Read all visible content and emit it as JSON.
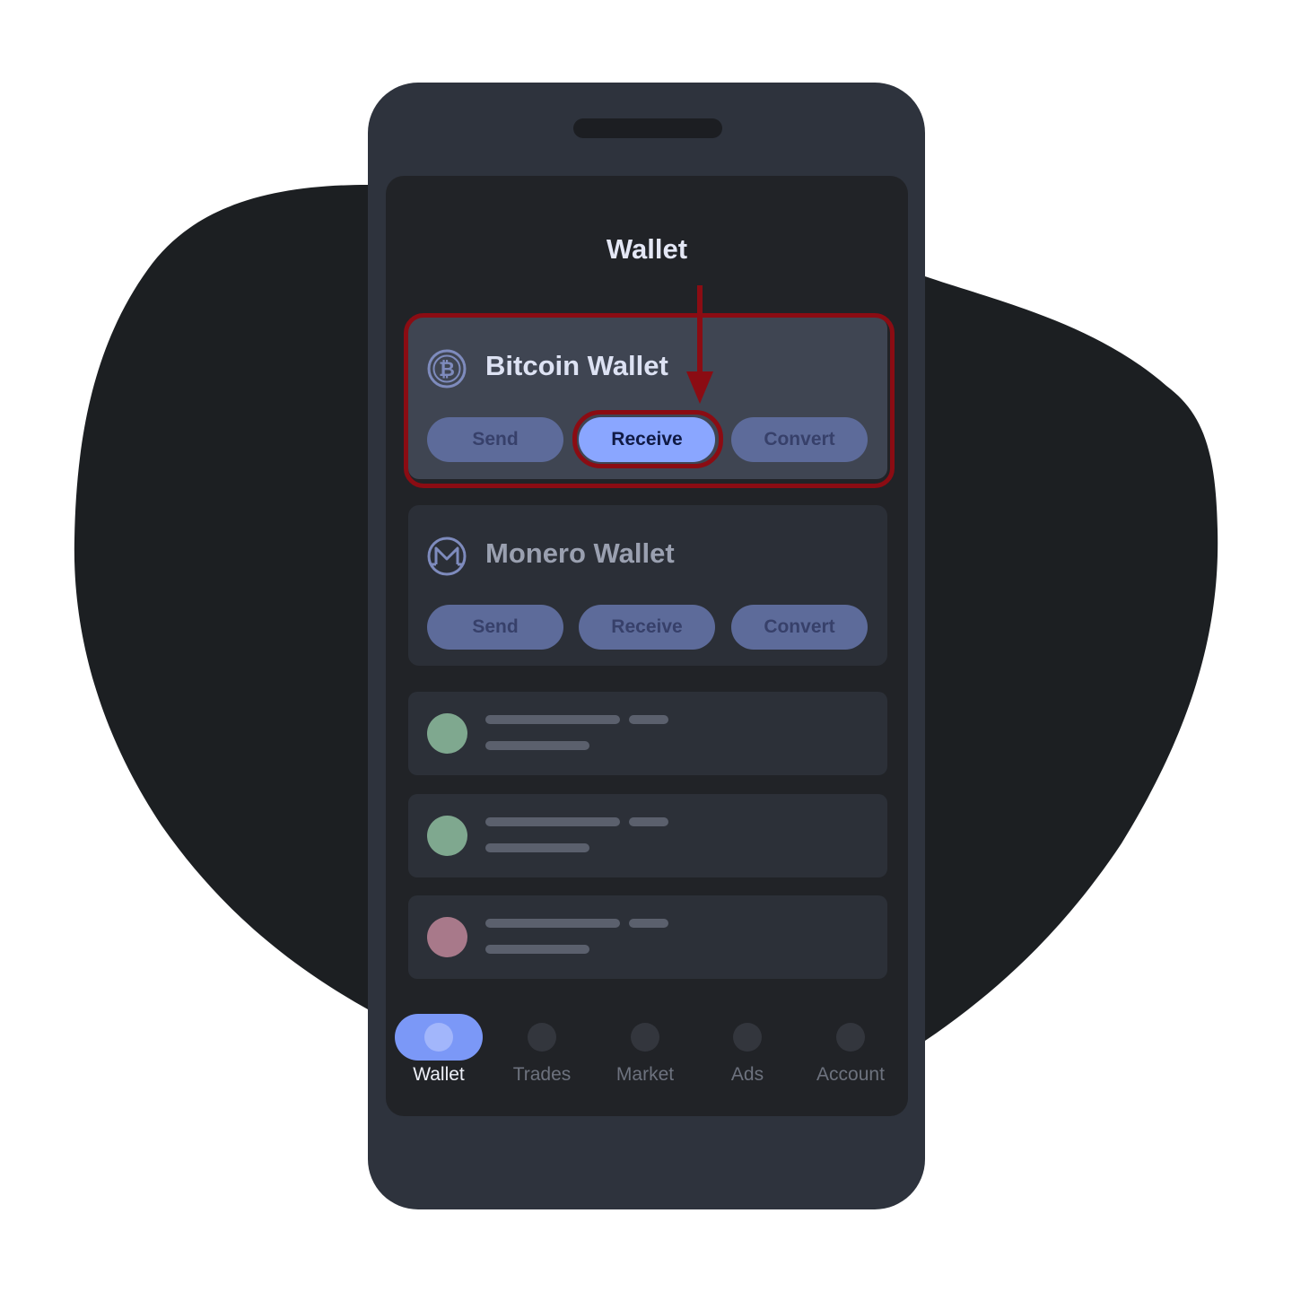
{
  "screen_title": "Wallet",
  "wallets": [
    {
      "name": "Bitcoin Wallet",
      "icon": "bitcoin-icon",
      "buttons": {
        "send": "Send",
        "receive": "Receive",
        "convert": "Convert"
      },
      "highlighted_action": "receive"
    },
    {
      "name": "Monero Wallet",
      "icon": "monero-icon",
      "buttons": {
        "send": "Send",
        "receive": "Receive",
        "convert": "Convert"
      }
    }
  ],
  "transactions": [
    {
      "status_color": "#7fa88f"
    },
    {
      "status_color": "#7fa88f"
    },
    {
      "status_color": "#a8798a"
    }
  ],
  "nav": {
    "items": [
      {
        "label": "Wallet",
        "active": true
      },
      {
        "label": "Trades"
      },
      {
        "label": "Market"
      },
      {
        "label": "Ads"
      },
      {
        "label": "Account"
      }
    ]
  },
  "colors": {
    "accent": "#8aa6ff",
    "highlight": "#8b0c13",
    "background_blob": "#1c1f22"
  }
}
